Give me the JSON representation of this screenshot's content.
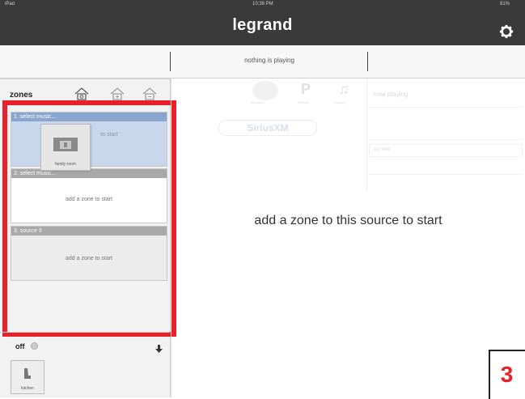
{
  "status_bar": {
    "device": "iPad",
    "time": "10:36 PM",
    "battery": "81%"
  },
  "app": {
    "title": "legrand"
  },
  "now_playing_strip": {
    "text": "nothing is playing"
  },
  "zones_panel": {
    "label": "zones",
    "zones": [
      {
        "title": "1. select music...",
        "body": "to start",
        "selected": true
      },
      {
        "title": "2. select music...",
        "body": "add a zone to start",
        "selected": false
      },
      {
        "title": "3. source 3",
        "body": "add a zone to start",
        "selected": false
      }
    ],
    "dragged_tile": {
      "label": "family room"
    },
    "power_label": "off",
    "kitchen_tile": {
      "label": "kitchen"
    }
  },
  "source_area": {
    "ghost_tabs": [
      "favourites",
      "Presets",
      "Library"
    ],
    "ghost_now_playing": "now playing",
    "ghost_input": "up next",
    "brand_logo_text": "SiriusXM",
    "message": "add a zone to this source to start"
  },
  "annotation": {
    "number": "3",
    "color": "#e8202a"
  },
  "colors": {
    "title_bar": "#3a3a3a",
    "zone_selected_header": "#8aa6cf",
    "zone_selected_body": "#c9d7ec",
    "zone_header": "#a9a9a9",
    "highlight": "#e8202a"
  }
}
